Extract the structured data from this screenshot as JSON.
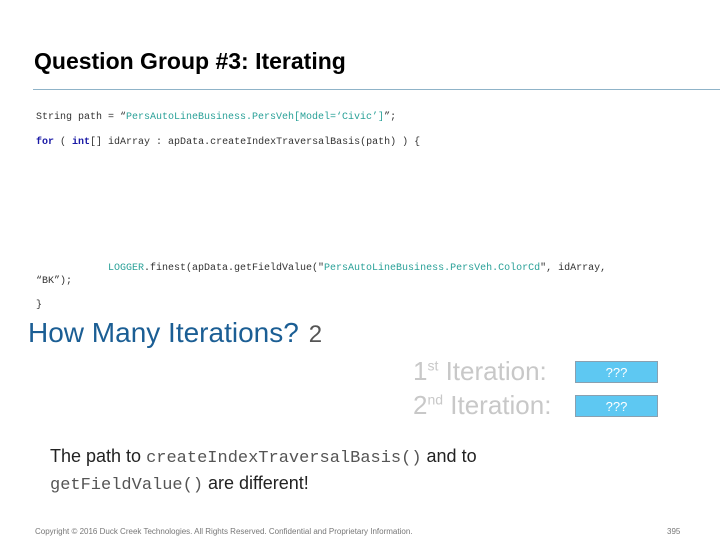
{
  "slide": {
    "title": "Question Group #3: Iterating",
    "code": {
      "line1": {
        "pre": "String path = “",
        "str": "PersAutoLineBusiness.PersVeh[Model=‘Civic’]",
        "post": "”;"
      },
      "line2": {
        "kw1": "for",
        "a": " ( ",
        "kw2": "int",
        "b": "[] idArray : apData.createIndexTraversalBasis(path) ) {"
      },
      "line3": {
        "cls": "LOGGER",
        "a": ".finest(apData.getFieldValue(\"",
        "str": "PersAutoLineBusiness.PersVeh.ColorCd",
        "b": "\", idArray,"
      },
      "line4": "“BK”);",
      "line5": "}"
    },
    "question": {
      "text": "How Many Iterations?",
      "answer": "2"
    },
    "iterations": [
      {
        "ordinal": "1",
        "suffix": "st",
        "label": " Iteration:",
        "button": "???"
      },
      {
        "ordinal": "2",
        "suffix": "nd",
        "label": " Iteration:",
        "button": "???"
      }
    ],
    "note": {
      "p1": "The path to ",
      "m1": "createIndexTraversalBasis()",
      "p2": " and to",
      "m2": "getFieldValue()",
      "p3": " are different!"
    },
    "footer": "Copyright © 2016 Duck Creek Technologies. All Rights Reserved. Confidential and Proprietary Information.",
    "page_number": "395"
  }
}
